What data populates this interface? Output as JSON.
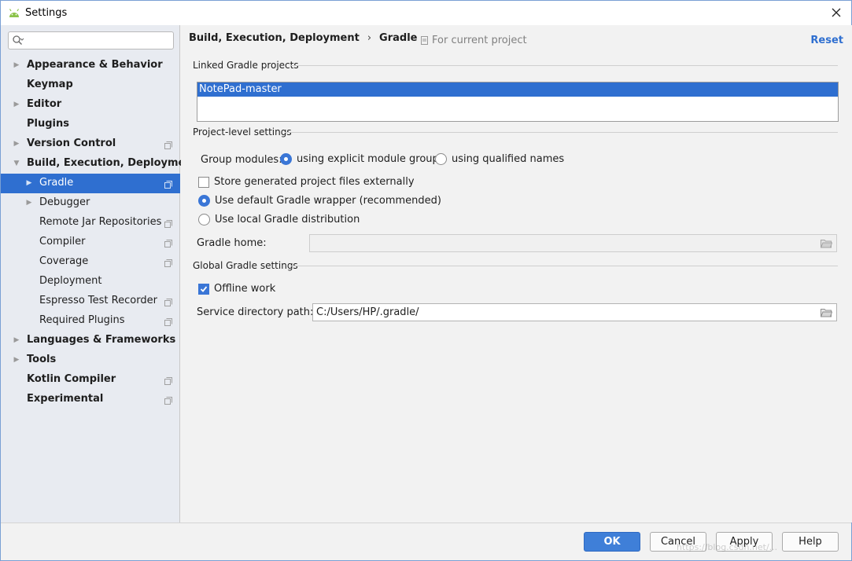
{
  "window": {
    "title": "Settings"
  },
  "search": {
    "placeholder": "",
    "value": ""
  },
  "sidebar": {
    "items": [
      {
        "label": "Appearance & Behavior",
        "bold": true,
        "arrow": "right",
        "level": 0,
        "proj": false
      },
      {
        "label": "Keymap",
        "bold": true,
        "arrow": "",
        "level": 0,
        "proj": false
      },
      {
        "label": "Editor",
        "bold": true,
        "arrow": "right",
        "level": 0,
        "proj": false
      },
      {
        "label": "Plugins",
        "bold": true,
        "arrow": "",
        "level": 0,
        "proj": false
      },
      {
        "label": "Version Control",
        "bold": true,
        "arrow": "right",
        "level": 0,
        "proj": true
      },
      {
        "label": "Build, Execution, Deployment",
        "bold": true,
        "arrow": "down",
        "level": 0,
        "proj": false
      },
      {
        "label": "Gradle",
        "bold": false,
        "arrow": "right",
        "level": 1,
        "proj": true,
        "selected": true
      },
      {
        "label": "Debugger",
        "bold": false,
        "arrow": "right",
        "level": 1,
        "proj": false
      },
      {
        "label": "Remote Jar Repositories",
        "bold": false,
        "arrow": "",
        "level": 1,
        "proj": true
      },
      {
        "label": "Compiler",
        "bold": false,
        "arrow": "",
        "level": 1,
        "proj": true
      },
      {
        "label": "Coverage",
        "bold": false,
        "arrow": "",
        "level": 1,
        "proj": true
      },
      {
        "label": "Deployment",
        "bold": false,
        "arrow": "",
        "level": 1,
        "proj": false
      },
      {
        "label": "Espresso Test Recorder",
        "bold": false,
        "arrow": "",
        "level": 1,
        "proj": true
      },
      {
        "label": "Required Plugins",
        "bold": false,
        "arrow": "",
        "level": 1,
        "proj": true
      },
      {
        "label": "Languages & Frameworks",
        "bold": true,
        "arrow": "right",
        "level": 0,
        "proj": false
      },
      {
        "label": "Tools",
        "bold": true,
        "arrow": "right",
        "level": 0,
        "proj": false
      },
      {
        "label": "Kotlin Compiler",
        "bold": true,
        "arrow": "",
        "level": 0,
        "proj": true
      },
      {
        "label": "Experimental",
        "bold": true,
        "arrow": "",
        "level": 0,
        "proj": true
      }
    ]
  },
  "header": {
    "crumb_parent": "Build, Execution, Deployment",
    "crumb_sep": "›",
    "crumb_current": "Gradle",
    "for_project": "For current project",
    "reset": "Reset"
  },
  "linked": {
    "title": "Linked Gradle projects",
    "projects": [
      "NotePad-master"
    ]
  },
  "project_settings": {
    "title": "Project-level settings",
    "group_modules_label": "Group modules:",
    "group_option_1": "using explicit module groups",
    "group_option_2": "using qualified names",
    "group_selected": 1,
    "store_generated": "Store generated project files externally",
    "store_generated_checked": false,
    "use_wrapper": "Use default Gradle wrapper (recommended)",
    "use_local": "Use local Gradle distribution",
    "distribution_selected": "wrapper",
    "gradle_home_label": "Gradle home:",
    "gradle_home_value": ""
  },
  "global_settings": {
    "title": "Global Gradle settings",
    "offline_work": "Offline work",
    "offline_checked": true,
    "service_dir_label": "Service directory path:",
    "service_dir_value": "C:/Users/HP/.gradle/"
  },
  "buttons": {
    "ok": "OK",
    "cancel": "Cancel",
    "apply": "Apply",
    "help": "Help"
  },
  "colors": {
    "accent": "#2f6fd0",
    "sidebar_bg": "#e8ebf1",
    "panel_bg": "#f2f2f2"
  },
  "watermark": "https://blog.csdn.net/..."
}
